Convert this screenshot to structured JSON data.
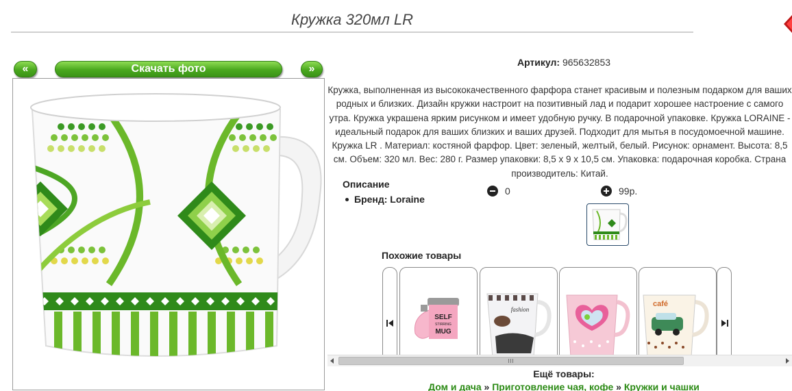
{
  "product": {
    "title": "Кружка 320мл LR",
    "article_label": "Артикул:",
    "article_value": "965632853",
    "description": "Кружка, выполненная из высококачественного фарфора станет красивым и полезным подарком для ваших родных и близких. Дизайн кружки настроит на позитивный лад и подарит хорошее настроение с самого утра. Кружка украшена ярким рисунком и имеет удобную ручку. В подарочной упаковке. Кружка LORAINE - идеальный подарок для ваших близких и ваших друзей. Подходит для мытья в посудомоечной машине. Кружка LR . Материал: костяной фарфор. Цвет: зеленый, желтый, белый. Рисунок: орнамент. Высота: 8,5 см. Объем: 320 мл. Вес: 280 г. Размер упаковки: 8,5 х 9 х 10,5 см. Упаковка: подарочная коробка. Страна производитель: Китай."
  },
  "gallery": {
    "prev_label": "«",
    "download_label": "Скачать фото",
    "next_label": "»"
  },
  "specs": {
    "heading": "Описание",
    "brand_label": "Бренд:",
    "brand_value": "Loraine"
  },
  "counters": {
    "minus_value": "0",
    "plus_value": "99р."
  },
  "similar": {
    "heading": "Похожие товары",
    "cards": [
      {
        "text_lines": [
          "SELF",
          "STIRRING",
          "MUG"
        ]
      },
      {
        "text_lines": [
          "fashion"
        ]
      },
      {
        "text_lines": []
      },
      {
        "text_lines": [
          "café"
        ]
      }
    ]
  },
  "more": {
    "heading": "Ещё товары:",
    "breadcrumb": [
      "Дом и дача",
      "Приготовление чая, кофе",
      "Кружки и чашки"
    ],
    "separator": "»"
  },
  "colors": {
    "accent_green": "#4aa81e",
    "link_green": "#2b8a14",
    "corner_red": "#e02020"
  }
}
